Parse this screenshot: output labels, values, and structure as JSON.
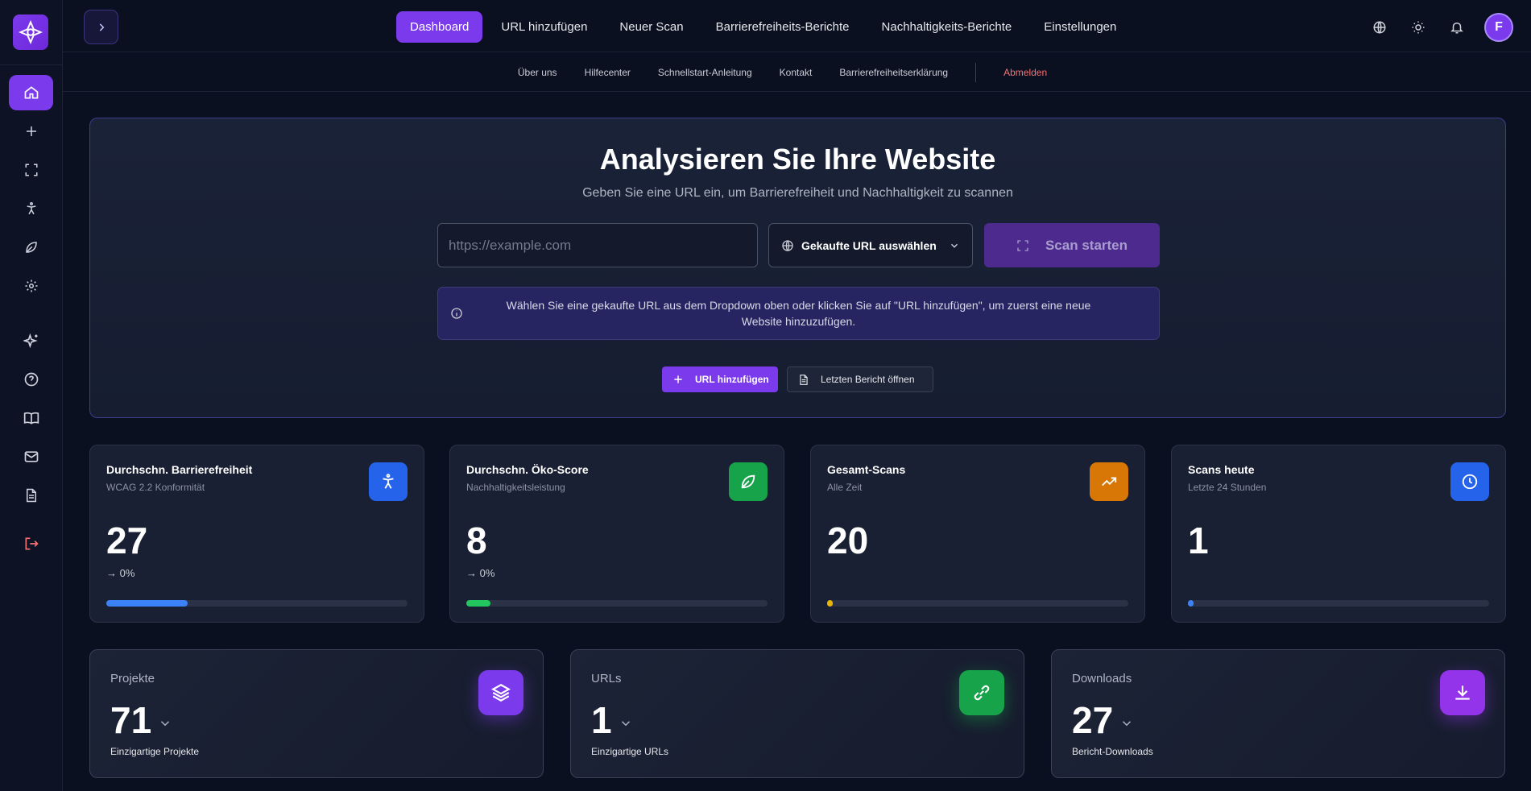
{
  "brand": {
    "accent": "#7c3aed",
    "logo_icon": "compass-logo-icon"
  },
  "sidebar": {
    "items": [
      {
        "name": "home",
        "icon": "home-icon",
        "active": true
      },
      {
        "name": "add",
        "icon": "plus-icon"
      },
      {
        "name": "scan",
        "icon": "scan-frame-icon"
      },
      {
        "name": "accessibility",
        "icon": "accessibility-icon"
      },
      {
        "name": "sustainability",
        "icon": "leaf-icon"
      },
      {
        "name": "settings",
        "icon": "gear-icon"
      },
      {
        "name": "ai",
        "icon": "sparkles-icon"
      },
      {
        "name": "help",
        "icon": "help-circle-icon"
      },
      {
        "name": "docs",
        "icon": "book-icon"
      },
      {
        "name": "contact",
        "icon": "mail-icon"
      },
      {
        "name": "report",
        "icon": "file-text-icon"
      },
      {
        "name": "logout",
        "icon": "logout-icon"
      }
    ]
  },
  "nav": {
    "main": [
      "Dashboard",
      "URL hinzufügen",
      "Neuer Scan",
      "Barrierefreiheits-Berichte",
      "Nachhaltigkeits-Berichte",
      "Einstellungen"
    ],
    "active": "Dashboard",
    "sub": [
      "Über uns",
      "Hilfecenter",
      "Schnellstart-Anleitung",
      "Kontakt",
      "Barrierefreiheitserklärung"
    ],
    "logout": "Abmelden",
    "avatar_initial": "F"
  },
  "hero": {
    "title": "Analysieren Sie Ihre Website",
    "subtitle": "Geben Sie eine URL ein, um Barrierefreiheit und Nachhaltigkeit zu scannen",
    "url_placeholder": "https://example.com",
    "select_label": "Gekaufte URL auswählen",
    "scan_label": "Scan starten",
    "info": "Wählen Sie eine gekaufte URL aus dem Dropdown oben oder klicken Sie auf \"URL hinzufügen\", um zuerst eine neue Website hinzuzufügen.",
    "add_url_label": "URL hinzufügen",
    "open_report_label": "Letzten Bericht öffnen"
  },
  "stats": [
    {
      "title": "Durchschn. Barrierefreiheit",
      "subtitle": "WCAG 2.2 Konformität",
      "value": "27",
      "trend": "→ 0%",
      "progress": 0.27,
      "color": "#3b82f6",
      "icon": "accessibility-icon"
    },
    {
      "title": "Durchschn. Öko-Score",
      "subtitle": "Nachhaltigkeitsleistung",
      "value": "8",
      "trend": "→ 0%",
      "progress": 0.08,
      "color": "#22c55e",
      "icon": "leaf-icon"
    },
    {
      "title": "Gesamt-Scans",
      "subtitle": "Alle Zeit",
      "value": "20",
      "trend": "",
      "progress": 0.0,
      "color": "#eab308",
      "icon": "trending-up-icon"
    },
    {
      "title": "Scans heute",
      "subtitle": "Letzte 24 Stunden",
      "value": "1",
      "trend": "",
      "progress": 0.0,
      "color": "#3b82f6",
      "icon": "clock-icon"
    }
  ],
  "stat_icon_colors": [
    "#2563eb",
    "#16a34a",
    "#f59e0b",
    "#2563eb"
  ],
  "summary": [
    {
      "label": "Projekte",
      "value": "71",
      "desc": "Einzigartige Projekte",
      "icon": "layers-icon",
      "color": "#7c3aed"
    },
    {
      "label": "URLs",
      "value": "1",
      "desc": "Einzigartige URLs",
      "icon": "link-icon",
      "color": "#16a34a"
    },
    {
      "label": "Downloads",
      "value": "27",
      "desc": "Bericht-Downloads",
      "icon": "download-icon",
      "color": "#9333ea"
    }
  ]
}
